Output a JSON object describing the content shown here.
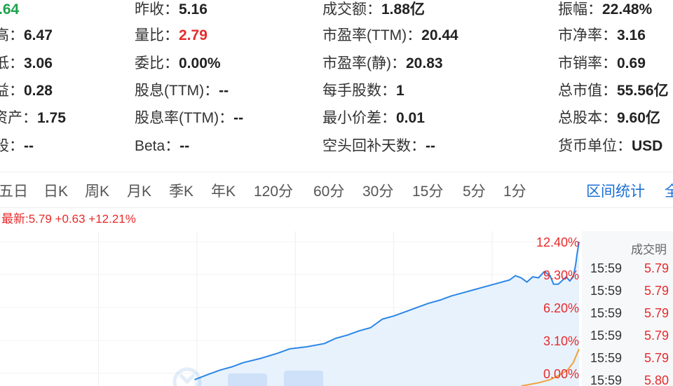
{
  "stats": {
    "col1": [
      {
        "label": "",
        "value": ".64"
      },
      {
        "label": "高：",
        "value": "6.47"
      },
      {
        "label": "低：",
        "value": "3.06"
      },
      {
        "label": "益：",
        "value": "0.28"
      },
      {
        "label": "资产：",
        "value": "1.75"
      },
      {
        "label": "股：",
        "value": "--"
      }
    ],
    "col2": [
      {
        "label": "昨收：",
        "value": "5.16"
      },
      {
        "label": "量比：",
        "value": "2.79"
      },
      {
        "label": "委比：",
        "value": "0.00%"
      },
      {
        "label": "股息(TTM)：",
        "value": "--"
      },
      {
        "label": "股息率(TTM)：",
        "value": "--"
      },
      {
        "label": "Beta：",
        "value": "--"
      }
    ],
    "col3": [
      {
        "label": "成交额：",
        "value": "1.88亿"
      },
      {
        "label": "市盈率(TTM)：",
        "value": "20.44"
      },
      {
        "label": "市盈率(静)：",
        "value": "20.83"
      },
      {
        "label": "每手股数：",
        "value": "1"
      },
      {
        "label": "最小价差：",
        "value": "0.01"
      },
      {
        "label": "空头回补天数：",
        "value": "--"
      }
    ],
    "col4": [
      {
        "label": "振幅：",
        "value": "22.48%"
      },
      {
        "label": "市净率：",
        "value": "3.16"
      },
      {
        "label": "市销率：",
        "value": "0.69"
      },
      {
        "label": "总市值：",
        "value": "55.56亿"
      },
      {
        "label": "总股本：",
        "value": "9.60亿"
      },
      {
        "label": "货币单位：",
        "value": "USD"
      }
    ]
  },
  "colors": {
    "up": "#e62b2b",
    "green": "#1aa34a",
    "line": "#2b86e6",
    "fill": "#e8f2fd",
    "avg": "#f0a23c",
    "link": "#1a6fd6"
  },
  "tabs": [
    "五日",
    "日K",
    "周K",
    "月K",
    "季K",
    "年K",
    "120分",
    "60分",
    "30分",
    "15分",
    "5分",
    "1分"
  ],
  "tabs_right": [
    "区间统计",
    "全"
  ],
  "latest": "最新:5.79 +0.63 +12.21%",
  "chart_data": {
    "type": "line",
    "title": "",
    "xlabel": "",
    "ylabel": "",
    "right_axis_ticks": [
      "12.40%",
      "9.30%",
      "6.20%",
      "3.10%",
      "0.00%"
    ],
    "right_axis_values": [
      12.4,
      9.3,
      6.2,
      3.1,
      0.0
    ],
    "ylim": [
      -1.2,
      13.4
    ],
    "xlim": [
      0,
      100
    ],
    "grid": true,
    "series": [
      {
        "x": [
          0,
          33.6,
          36,
          38,
          40,
          42,
          45,
          48,
          50,
          53,
          56,
          58,
          60,
          62,
          64,
          66,
          68,
          70,
          72,
          74,
          76,
          78,
          80,
          82,
          84,
          86,
          88,
          89,
          90,
          91,
          92,
          93,
          94,
          95,
          95.6,
          96.4,
          97.2,
          97.8,
          98.4,
          99,
          99.4,
          99.7,
          100
        ],
        "values": [
          null,
          -0.6,
          -0.1,
          0.3,
          0.6,
          1.0,
          1.4,
          1.9,
          2.3,
          2.5,
          2.8,
          3.3,
          3.6,
          4.0,
          4.3,
          5.1,
          5.4,
          5.8,
          6.2,
          6.6,
          6.9,
          7.3,
          7.6,
          7.9,
          8.2,
          8.5,
          8.8,
          9.2,
          9.0,
          8.6,
          9.1,
          9.0,
          9.6,
          9.2,
          8.4,
          8.4,
          8.8,
          9.1,
          8.7,
          9.1,
          10.2,
          11.4,
          12.4
        ]
      },
      {
        "x": [
          90,
          93,
          95,
          96.5,
          98,
          99,
          100
        ],
        "values": [
          -1.2,
          -0.9,
          -0.6,
          -0.2,
          0.3,
          1.0,
          2.3
        ]
      }
    ]
  },
  "trades": {
    "title": "成交明",
    "rows": [
      {
        "time": "15:59",
        "price": "5.79"
      },
      {
        "time": "15:59",
        "price": "5.79"
      },
      {
        "time": "15:59",
        "price": "5.79"
      },
      {
        "time": "15:59",
        "price": "5.79"
      },
      {
        "time": "15:59",
        "price": "5.79"
      },
      {
        "time": "15:59",
        "price": "5.80"
      }
    ]
  }
}
